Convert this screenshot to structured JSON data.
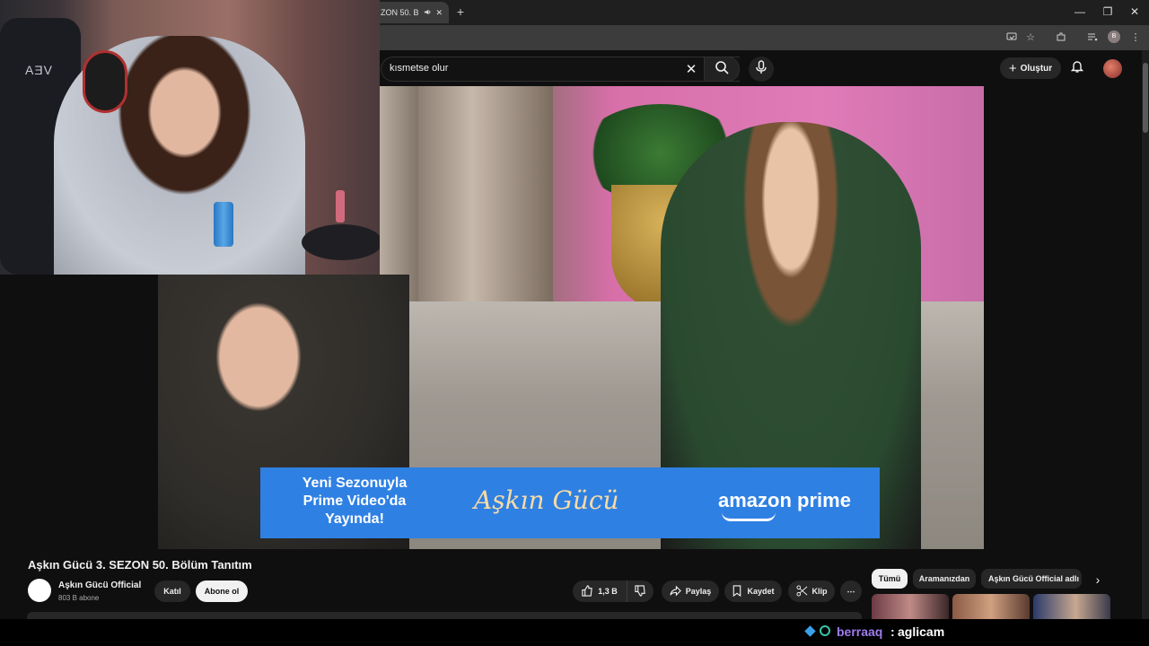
{
  "browser": {
    "tab_title": "ZON 50. B",
    "new_tab_symbol": "+",
    "window_controls": [
      "—",
      "❐",
      "✕"
    ],
    "profile_initial": "B"
  },
  "youtube": {
    "search": {
      "query": "kısmetse olur",
      "clear_symbol": "✕"
    },
    "create_label": "Oluştur",
    "video": {
      "banner": {
        "left_text": "Yeni Sezonuyla\nPrime Video'da\nYayında!",
        "show_logo": "Aşkın Gücü",
        "brand": "amazon prime"
      },
      "title": "Aşkın Gücü 3. SEZON 50. Bölüm Tanıtım"
    },
    "channel": {
      "name": "Aşkın Gücü Official",
      "subscribers": "803 B abone"
    },
    "buttons": {
      "join": "Katıl",
      "subscribe": "Abone ol",
      "likes": "1,3 B",
      "share": "Paylaş",
      "save": "Kaydet",
      "clip": "Klip",
      "more": "⋯"
    },
    "chips": [
      "Tümü",
      "Aramanızdan",
      "Aşkın Gücü Official adlı"
    ],
    "chip_next_symbol": "›"
  },
  "webcam": {
    "chair_text": "AƎV"
  },
  "chat": {
    "username": "berraaq",
    "separator": ":",
    "message": "aglicam"
  },
  "colors": {
    "chat_username": "#9e7cf0",
    "banner_bg": "#2f80e3",
    "subscribe_bg": "#f1f1f1"
  },
  "icons": [
    "speaker-icon",
    "close-icon",
    "cast-icon",
    "star-icon",
    "extensions-icon",
    "media-icon",
    "menu-icon",
    "search-icon",
    "mic-icon",
    "plus-icon",
    "bell-icon",
    "like-icon",
    "dislike-icon",
    "share-icon",
    "save-icon",
    "scissors-icon",
    "chevron-right-icon"
  ]
}
